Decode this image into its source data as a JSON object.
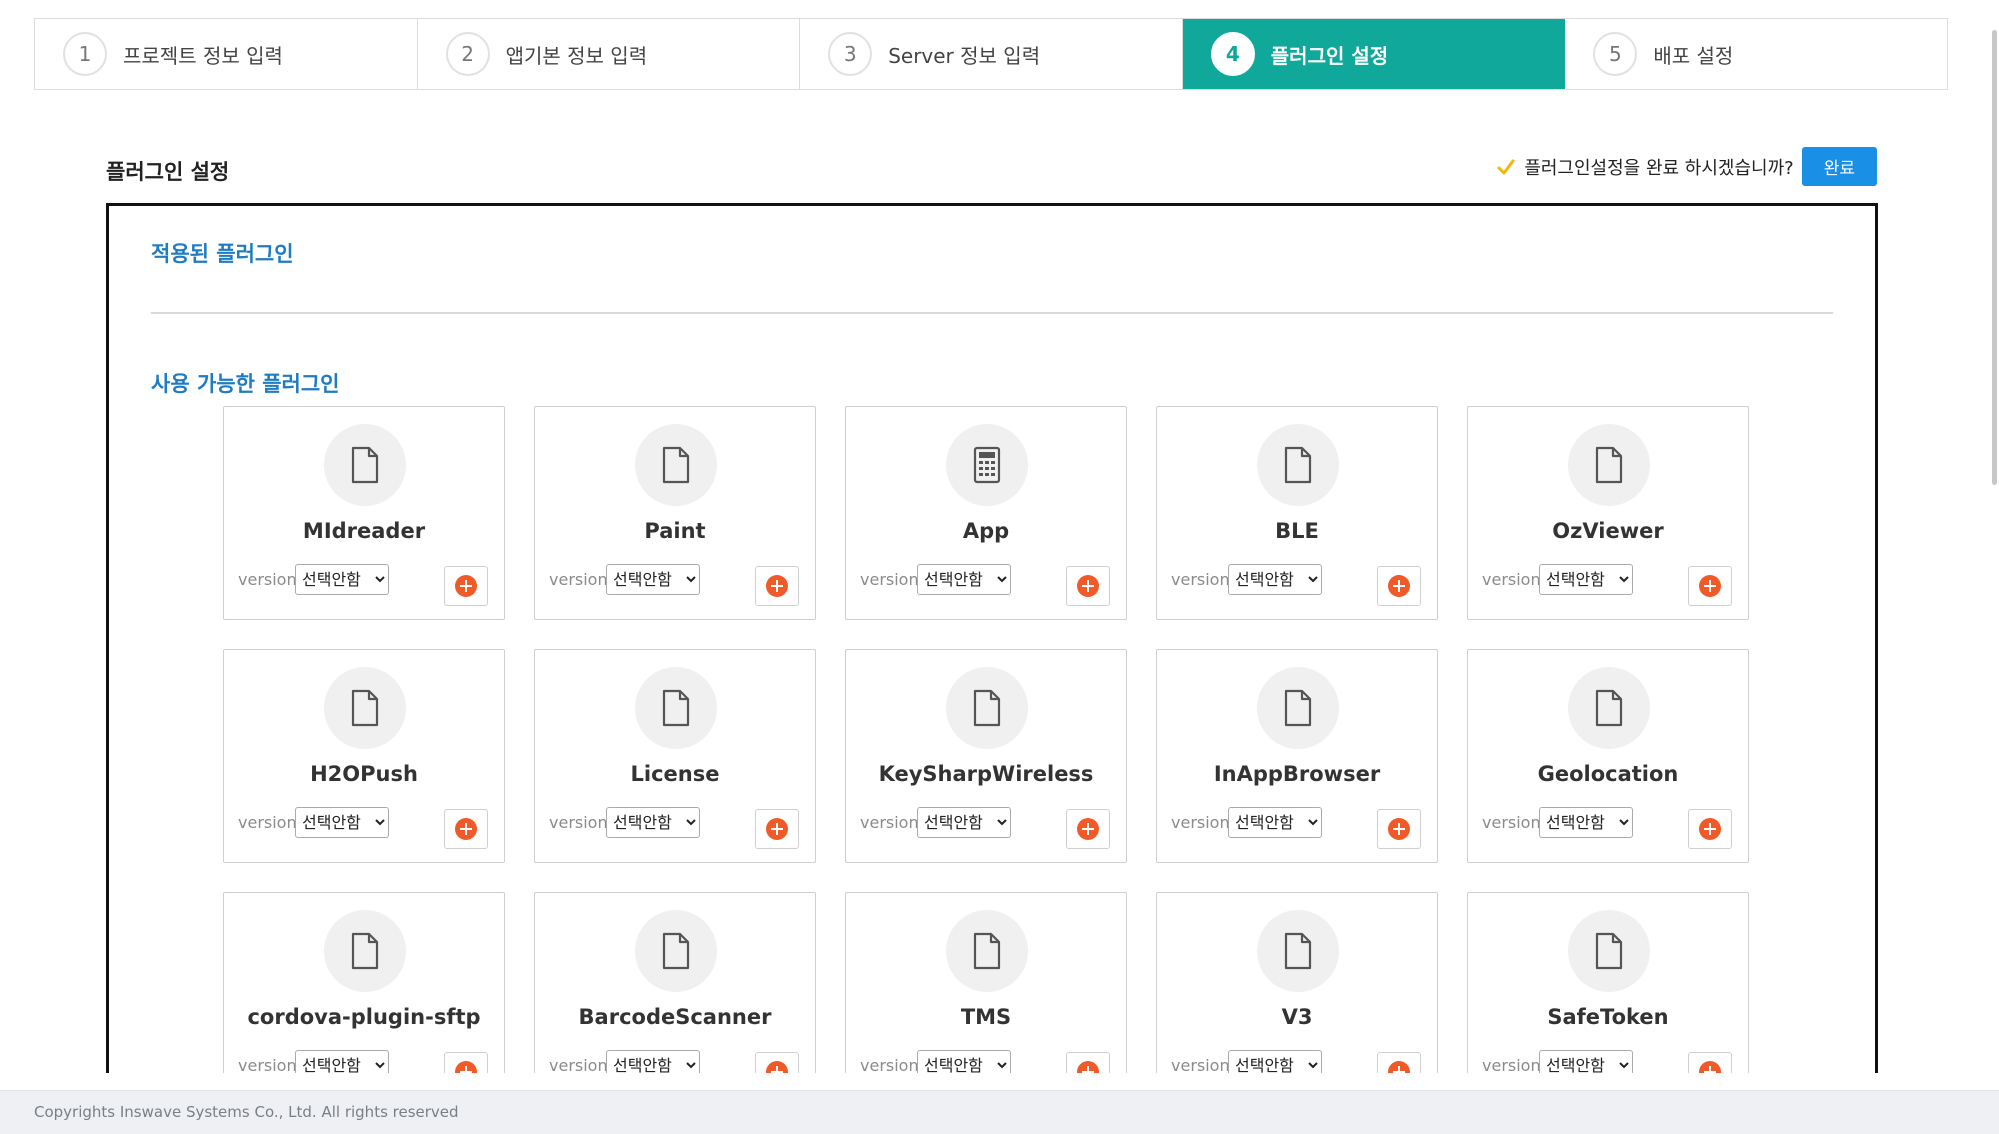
{
  "steps": [
    {
      "num": "1",
      "label": "프로젝트 정보 입력"
    },
    {
      "num": "2",
      "label": "앱기본 정보 입력"
    },
    {
      "num": "3",
      "label": "Server 정보 입력"
    },
    {
      "num": "4",
      "label": "플러그인 설정",
      "active": true
    },
    {
      "num": "5",
      "label": "배포 설정"
    }
  ],
  "header": {
    "title": "플러그인 설정",
    "complete_question": "플러그인설정을 완료 하시겠습니까?",
    "complete_button": "완료"
  },
  "panel": {
    "applied_title": "적용된 플러그인",
    "available_title": "사용 가능한 플러그인"
  },
  "plugin_common": {
    "version_label": "version",
    "select_value": "선택안함"
  },
  "plugins": [
    {
      "name": "MIdreader",
      "icon": "document-icon"
    },
    {
      "name": "Paint",
      "icon": "document-icon"
    },
    {
      "name": "App",
      "icon": "calculator-icon"
    },
    {
      "name": "BLE",
      "icon": "document-icon"
    },
    {
      "name": "OzViewer",
      "icon": "document-icon"
    },
    {
      "name": "H2OPush",
      "icon": "document-icon"
    },
    {
      "name": "License",
      "icon": "document-icon"
    },
    {
      "name": "KeySharpWireless",
      "icon": "document-icon"
    },
    {
      "name": "InAppBrowser",
      "icon": "document-icon"
    },
    {
      "name": "Geolocation",
      "icon": "document-icon"
    },
    {
      "name": "cordova-plugin-sftp",
      "icon": "document-icon"
    },
    {
      "name": "BarcodeScanner",
      "icon": "document-icon"
    },
    {
      "name": "TMS",
      "icon": "document-icon"
    },
    {
      "name": "V3",
      "icon": "document-icon"
    },
    {
      "name": "SafeToken",
      "icon": "document-icon"
    }
  ],
  "footer": {
    "copyright": "Copyrights Inswave Systems Co., Ltd. All rights reserved"
  },
  "colors": {
    "accent": "#0fa89a",
    "link": "#1f7cc2",
    "primary_button": "#1a8fe6",
    "add": "#f05a28",
    "check": "#f5b800"
  }
}
